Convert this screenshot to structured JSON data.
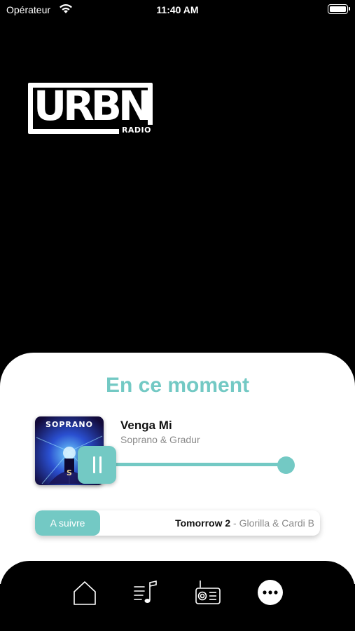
{
  "status_bar": {
    "carrier": "Opérateur",
    "time": "11:40 AM",
    "icons": [
      "wifi-icon",
      "battery-icon"
    ]
  },
  "logo": {
    "text": "URBN",
    "subtext": "RADIO"
  },
  "now_playing": {
    "section_title": "En ce moment",
    "track_title": "Venga Mi",
    "track_artist": "Soprano & Gradur",
    "cover_text": "SOPRANO",
    "state": "playing",
    "accent_color": "#73c9c4"
  },
  "up_next": {
    "label": "A suivre",
    "title": "Tomorrow 2",
    "separator": " - ",
    "artist": "Glorilla & Cardi B"
  },
  "tab_bar": {
    "items": [
      {
        "icon": "home-icon"
      },
      {
        "icon": "playlist-icon"
      },
      {
        "icon": "radio-icon"
      },
      {
        "icon": "more-icon",
        "active": true
      }
    ]
  }
}
